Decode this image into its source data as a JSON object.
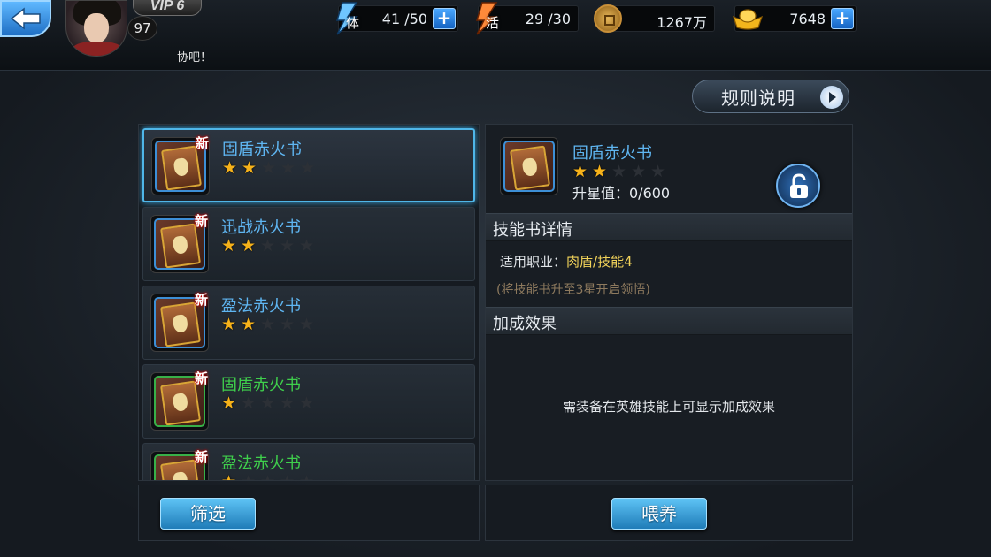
{
  "player": {
    "vip": "VIP 6",
    "level": "97"
  },
  "resources": {
    "stamina": {
      "icon": "lightning-stamina-icon",
      "glyph": "体",
      "value": "41 /50"
    },
    "energy": {
      "icon": "lightning-energy-icon",
      "glyph": "活",
      "value": "29 /30"
    },
    "coins": {
      "icon": "copper-coin-icon",
      "value": "1267万"
    },
    "gold": {
      "icon": "gold-ingot-icon",
      "value": "7648"
    }
  },
  "marquee": "协吧！",
  "rules_button": "规则说明",
  "book_list": [
    {
      "name": "固盾赤火书",
      "stars": 2,
      "tag": "新",
      "rarity": "blue",
      "selected": true
    },
    {
      "name": "迅战赤火书",
      "stars": 2,
      "tag": "新",
      "rarity": "blue",
      "selected": false
    },
    {
      "name": "盈法赤火书",
      "stars": 2,
      "tag": "新",
      "rarity": "blue",
      "selected": false
    },
    {
      "name": "固盾赤火书",
      "stars": 1,
      "tag": "新",
      "rarity": "green",
      "selected": false
    },
    {
      "name": "盈法赤火书",
      "stars": 1,
      "tag": "新",
      "rarity": "green",
      "selected": false
    }
  ],
  "detail": {
    "name": "固盾赤火书",
    "stars": 2,
    "max_stars": 5,
    "star_progress": "升星值：0/600",
    "skill_section_title": "技能书详情",
    "career_label": "适用职业：",
    "career_value": "肉盾/技能4",
    "unlock_hint": "(将技能书升至3星开启领悟)",
    "bonus_section_title": "加成效果",
    "bonus_empty": "需装备在英雄技能上可显示加成效果"
  },
  "buttons": {
    "filter": "筛选",
    "feed": "喂养"
  },
  "colors": {
    "blue_name": "#5fb6f2",
    "green_name": "#3fcf4c",
    "star_on": "#f6b21a",
    "highlight": "#f2d35a",
    "button": "#2f9bd8"
  }
}
